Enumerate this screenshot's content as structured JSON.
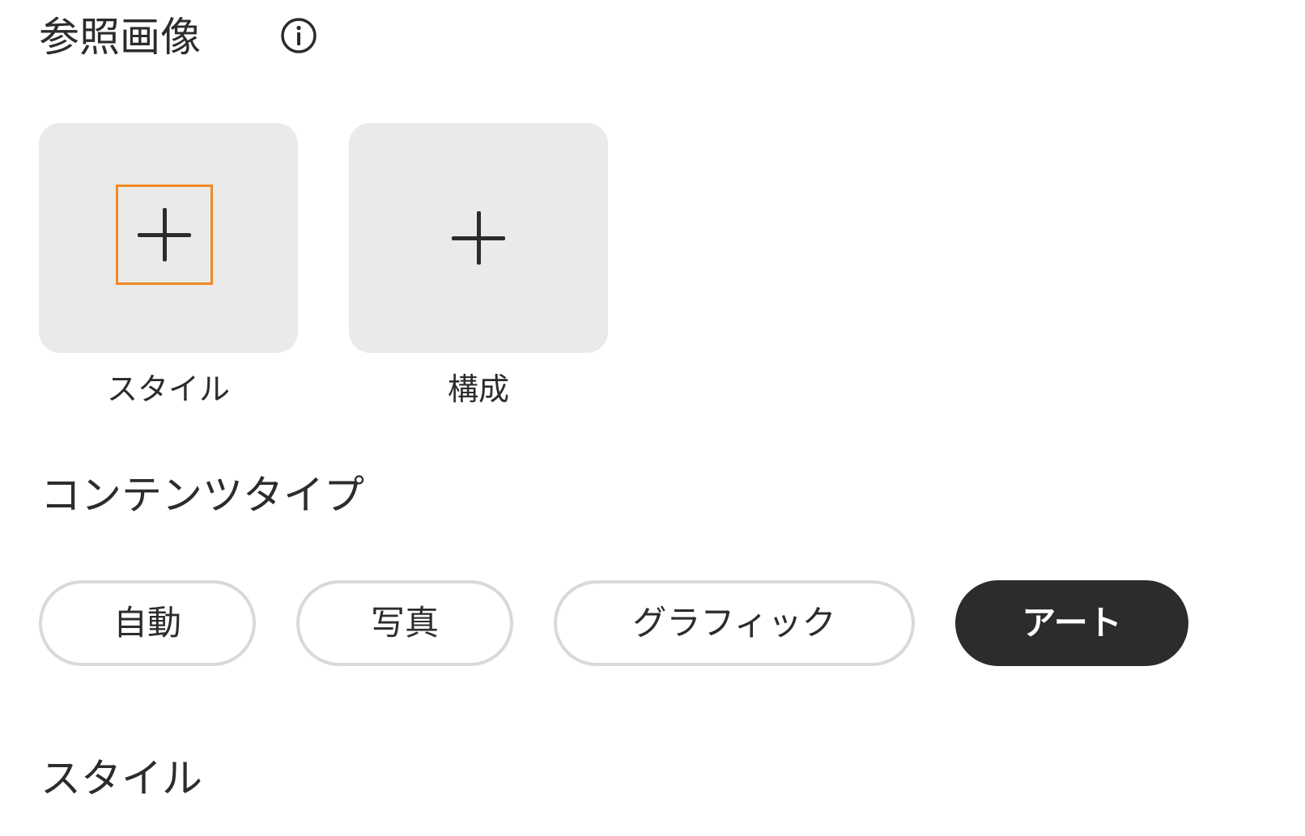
{
  "reference_images": {
    "title": "参照画像",
    "info_icon": "info-circle-icon",
    "tiles": [
      {
        "label": "スタイル",
        "icon": "plus-icon",
        "focused": true
      },
      {
        "label": "構成",
        "icon": "plus-icon",
        "focused": false
      }
    ]
  },
  "content_type": {
    "title": "コンテンツタイプ",
    "options": [
      {
        "label": "自動",
        "selected": false
      },
      {
        "label": "写真",
        "selected": false
      },
      {
        "label": "グラフィック",
        "selected": false
      },
      {
        "label": "アート",
        "selected": true
      }
    ]
  },
  "style_section": {
    "title": "スタイル"
  },
  "colors": {
    "text": "#2c2c2c",
    "tile_bg": "#eaeaea",
    "chip_border": "#d9d9d9",
    "selected_chip_bg": "#2c2c2c",
    "focus_outline": "#f08a24"
  }
}
